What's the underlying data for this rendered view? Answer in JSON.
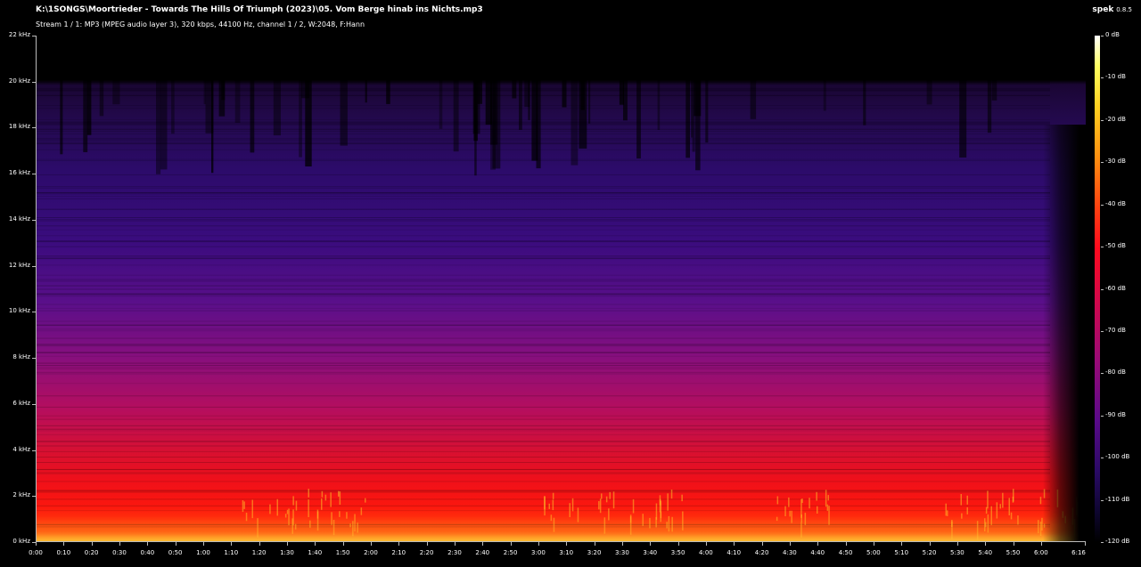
{
  "header": {
    "file_title": "K:\\1SONGS\\Moortrieder - Towards The Hills Of Triumph (2023)\\05. Vom Berge hinab ins Nichts.mp3",
    "stream_info": "Stream 1 / 1: MP3 (MPEG audio layer 3), 320 kbps, 44100 Hz, channel 1 / 2, W:2048, F:Hann",
    "app_name": "spek",
    "app_version": "0.8.5"
  },
  "freq_axis": {
    "labels": [
      "22 kHz",
      "20 kHz",
      "18 kHz",
      "16 kHz",
      "14 kHz",
      "12 kHz",
      "10 kHz",
      "8 kHz",
      "6 kHz",
      "4 kHz",
      "2 kHz",
      "0 kHz"
    ]
  },
  "time_axis": {
    "labels": [
      "0:00",
      "0:10",
      "0:20",
      "0:30",
      "0:40",
      "0:50",
      "1:00",
      "1:10",
      "1:20",
      "1:30",
      "1:40",
      "1:50",
      "2:00",
      "2:10",
      "2:20",
      "2:30",
      "2:40",
      "2:50",
      "3:00",
      "3:10",
      "3:20",
      "3:30",
      "3:40",
      "3:50",
      "4:00",
      "4:10",
      "4:20",
      "4:30",
      "4:40",
      "4:50",
      "5:00",
      "5:10",
      "5:20",
      "5:30",
      "5:40",
      "5:50",
      "6:00"
    ],
    "end_label": "6:16"
  },
  "colorbar": {
    "labels": [
      "0 dB",
      "-10 dB",
      "-20 dB",
      "-30 dB",
      "-40 dB",
      "-50 dB",
      "-60 dB",
      "-70 dB",
      "-80 dB",
      "-90 dB",
      "-100 dB",
      "-110 dB",
      "-120 dB"
    ]
  },
  "spectrogram": {
    "duration_seconds": 376,
    "max_frequency_khz": 22,
    "cutoff_frequency_khz": 20
  }
}
